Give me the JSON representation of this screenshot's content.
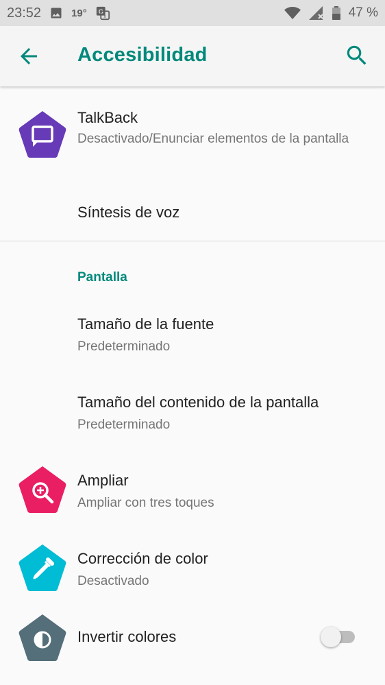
{
  "status_bar": {
    "time": "23:52",
    "temperature": "19°",
    "battery": "47 %",
    "icons": [
      "image-icon",
      "translate-icon",
      "wifi-icon",
      "signal-icon",
      "battery-icon"
    ]
  },
  "app_bar": {
    "title": "Accesibilidad",
    "back_icon": "arrow-back-icon",
    "search_icon": "search-icon"
  },
  "items": {
    "talkback": {
      "title": "TalkBack",
      "subtitle": "Desactivado/Enunciar elementos de la pantalla",
      "icon": "message-icon",
      "color": "#673ab7"
    },
    "tts": {
      "title": "Síntesis de voz"
    },
    "section_display": "Pantalla",
    "font_size": {
      "title": "Tamaño de la fuente",
      "subtitle": "Predeterminado"
    },
    "display_size": {
      "title": "Tamaño del contenido de la pantalla",
      "subtitle": "Predeterminado"
    },
    "magnify": {
      "title": "Ampliar",
      "subtitle": "Ampliar con tres toques",
      "icon": "magnify-icon",
      "color": "#e91e63"
    },
    "color_correction": {
      "title": "Corrección de color",
      "subtitle": "Desactivado",
      "icon": "eyedropper-icon",
      "color": "#00bcd4"
    },
    "invert_colors": {
      "title": "Invertir colores",
      "icon": "contrast-icon",
      "color": "#546e7a",
      "toggle_on": false
    }
  },
  "colors": {
    "accent": "#00897b",
    "status_bar": "#e0e0e0",
    "background": "#fafafa"
  }
}
